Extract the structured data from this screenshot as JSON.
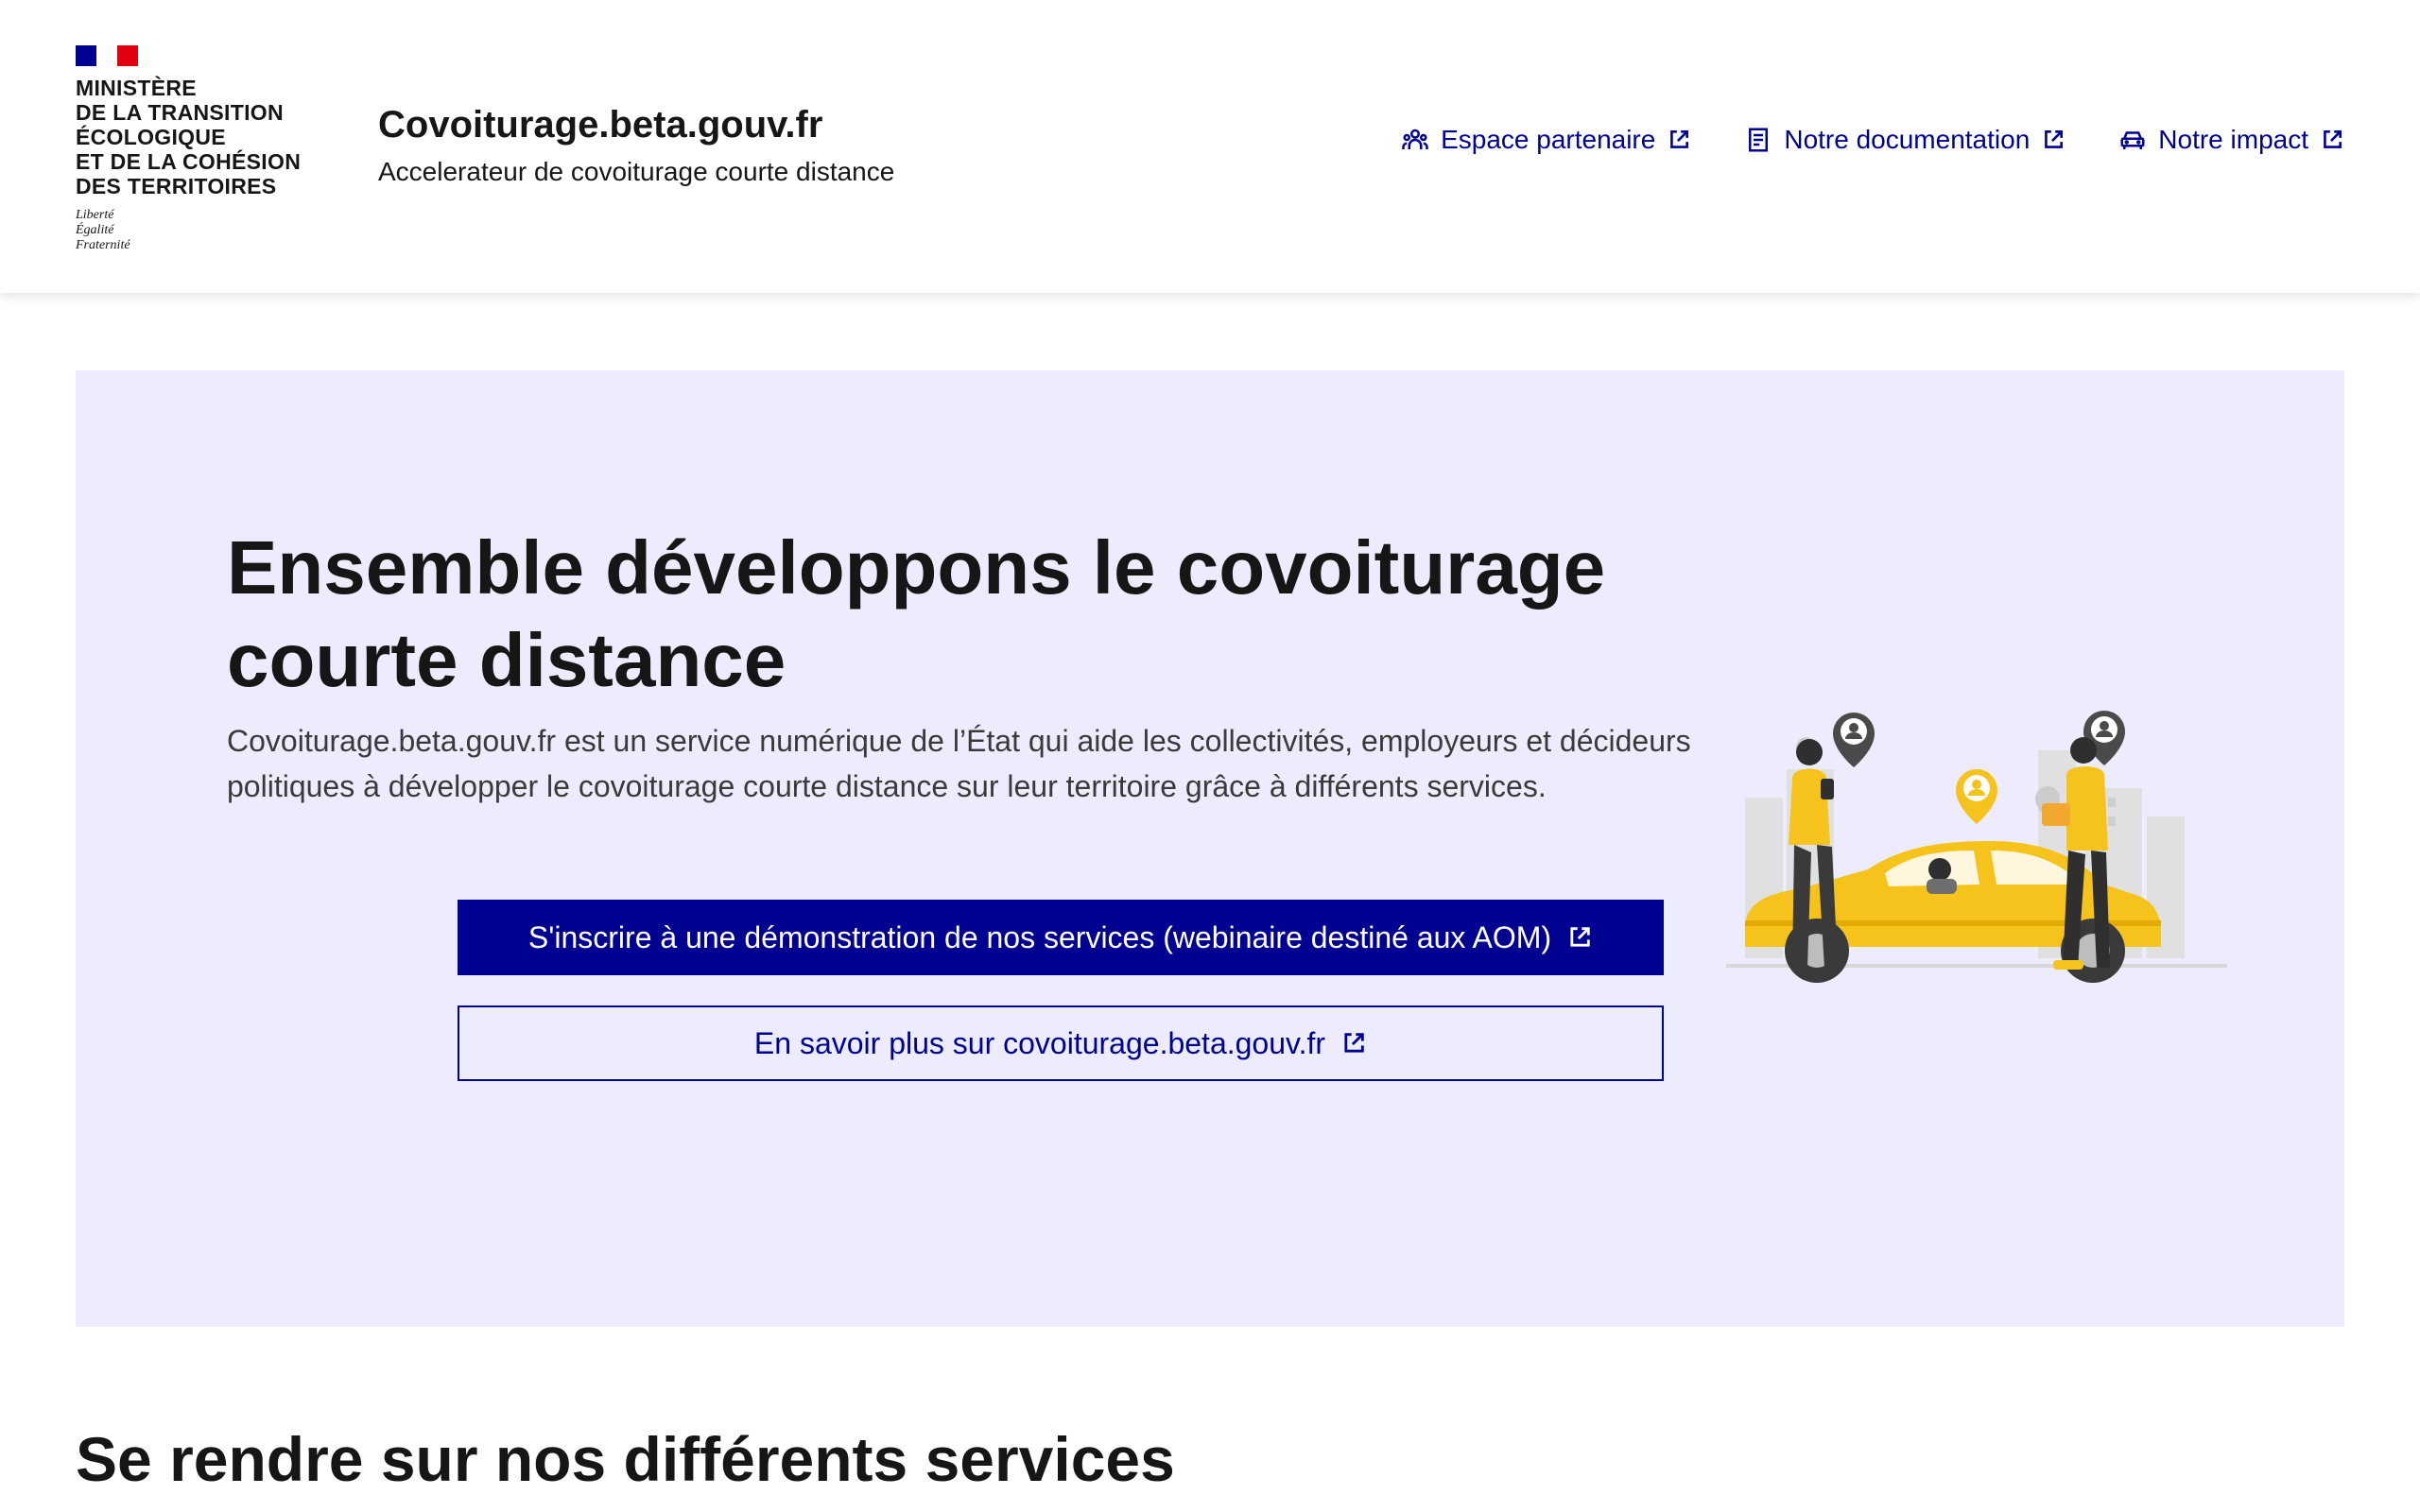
{
  "header": {
    "ministry": "Ministère\nde la transition\nécologique\net de la cohésion\ndes territoires",
    "motto": "Liberté\nÉgalité\nFraternité",
    "service_title": "Covoiturage.beta.gouv.fr",
    "service_tagline": "Accelerateur de covoiturage courte distance",
    "nav": [
      {
        "label": "Espace partenaire",
        "icon": "team-icon"
      },
      {
        "label": "Notre documentation",
        "icon": "document-icon"
      },
      {
        "label": "Notre impact",
        "icon": "car-icon"
      }
    ]
  },
  "hero": {
    "title": "Ensemble développons le covoiturage courte distance",
    "description": "Covoiturage.beta.gouv.fr est un service numérique de l’État qui aide les collectivités, employeurs et décideurs politiques à développer le covoiturage courte distance sur leur territoire grâce à différents services.",
    "primary_button": "S'inscrire à une démonstration de nos services (webinaire destiné aux AOM)",
    "secondary_button": "En savoir plus sur covoiturage.beta.gouv.fr"
  },
  "section": {
    "title": "Se rendre sur nos différents services"
  },
  "colors": {
    "primary": "#000091",
    "hero_background": "#ececfe",
    "flag_red": "#e1000f",
    "car_yellow": "#f6c21c"
  }
}
